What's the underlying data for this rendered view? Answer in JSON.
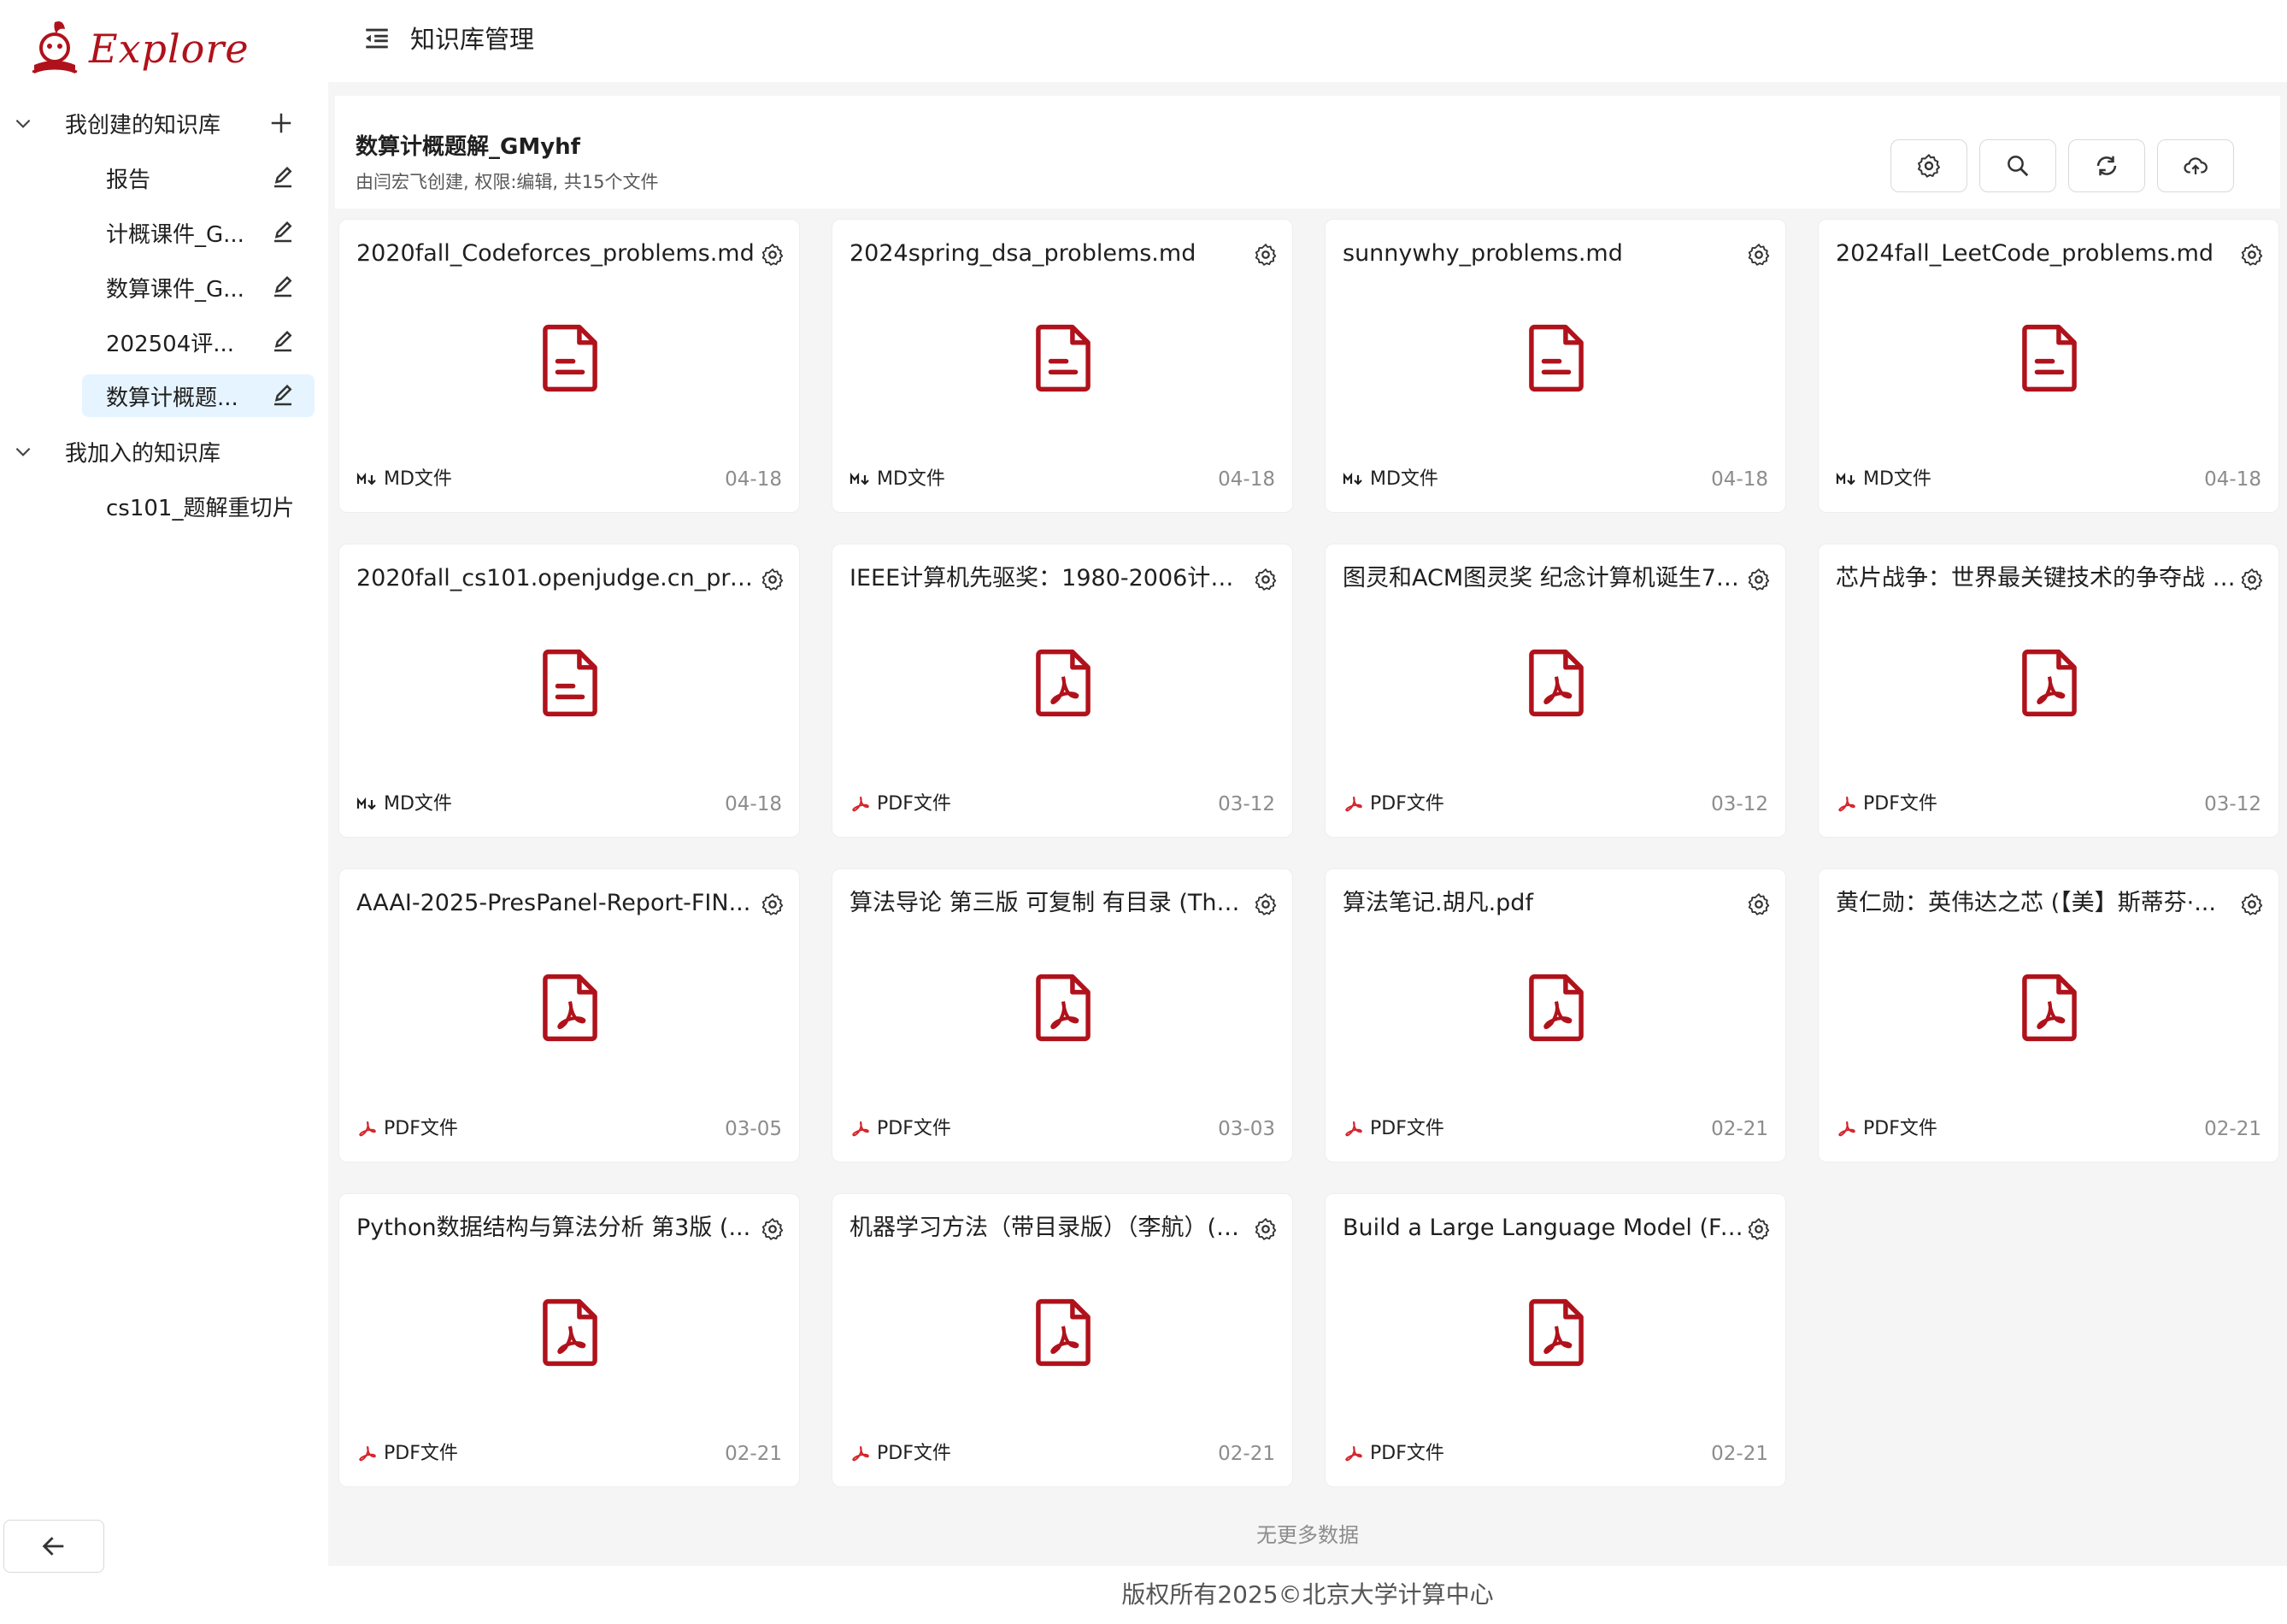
{
  "app": {
    "logo_text": "Explore"
  },
  "header": {
    "title": "知识库管理"
  },
  "sidebar": {
    "created_section": {
      "label": "我创建的知识库",
      "items": [
        {
          "label": "报告"
        },
        {
          "label": "计概课件_G..."
        },
        {
          "label": "数算课件_G..."
        },
        {
          "label": "202504评..."
        },
        {
          "label": "数算计概题...",
          "selected": true
        }
      ]
    },
    "joined_section": {
      "label": "我加入的知识库",
      "items": [
        {
          "label": "cs101_题解重切片"
        }
      ]
    }
  },
  "kb": {
    "name": "数算计概题解_GMyhf",
    "desc": "由闫宏飞创建, 权限:编辑, 共15个文件"
  },
  "files": [
    {
      "name": "2020fall_Codeforces_problems.md",
      "type": "MD文件",
      "kind": "md",
      "date": "04-18"
    },
    {
      "name": "2024spring_dsa_problems.md",
      "type": "MD文件",
      "kind": "md",
      "date": "04-18"
    },
    {
      "name": "sunnywhy_problems.md",
      "type": "MD文件",
      "kind": "md",
      "date": "04-18"
    },
    {
      "name": "2024fall_LeetCode_problems.md",
      "type": "MD文件",
      "kind": "md",
      "date": "04-18"
    },
    {
      "name": "2020fall_cs101.openjudge.cn_pro...",
      "type": "MD文件",
      "kind": "md",
      "date": "04-18"
    },
    {
      "name": "IEEE计算机先驱奖：1980-2006计算...",
      "type": "PDF文件",
      "kind": "pdf",
      "date": "03-12"
    },
    {
      "name": "图灵和ACM图灵奖 纪念计算机诞生70...",
      "type": "PDF文件",
      "kind": "pdf",
      "date": "03-12"
    },
    {
      "name": "芯片战争：世界最关键技术的争夺战 (...",
      "type": "PDF文件",
      "kind": "pdf",
      "date": "03-12"
    },
    {
      "name": "AAAI-2025-PresPanel-Report-FIN...",
      "type": "PDF文件",
      "kind": "pdf",
      "date": "03-05"
    },
    {
      "name": "算法导论 第三版 可复制 有目录 (Thm...",
      "type": "PDF文件",
      "kind": "pdf",
      "date": "03-03"
    },
    {
      "name": "算法笔记.胡凡.pdf",
      "type": "PDF文件",
      "kind": "pdf",
      "date": "02-21"
    },
    {
      "name": "黄仁勋：英伟达之芯 (【美】斯蒂芬·...",
      "type": "PDF文件",
      "kind": "pdf",
      "date": "02-21"
    },
    {
      "name": "Python数据结构与算法分析 第3版 (...",
      "type": "PDF文件",
      "kind": "pdf",
      "date": "02-21"
    },
    {
      "name": "机器学习方法（带目录版）（李航）(Z...",
      "type": "PDF文件",
      "kind": "pdf",
      "date": "02-21"
    },
    {
      "name": "Build a Large Language Model (Fro...",
      "type": "PDF文件",
      "kind": "pdf",
      "date": "02-21"
    }
  ],
  "list_end_text": "无更多数据",
  "footer": {
    "text": "版权所有2025©北京大学计算中心"
  },
  "colors": {
    "brand": "#b0121b",
    "accent_bg": "#e6f4ff",
    "md_icon": "#1f1f1f",
    "pdf_icon": "#d4242b"
  },
  "icons": {
    "header_buttons": [
      "settings-icon",
      "search-icon",
      "refresh-icon",
      "cloud-upload-icon"
    ],
    "card": [
      "gear-icon",
      "file-text-icon",
      "file-pdf-icon",
      "markdown-icon",
      "pdf-small-icon"
    ]
  }
}
